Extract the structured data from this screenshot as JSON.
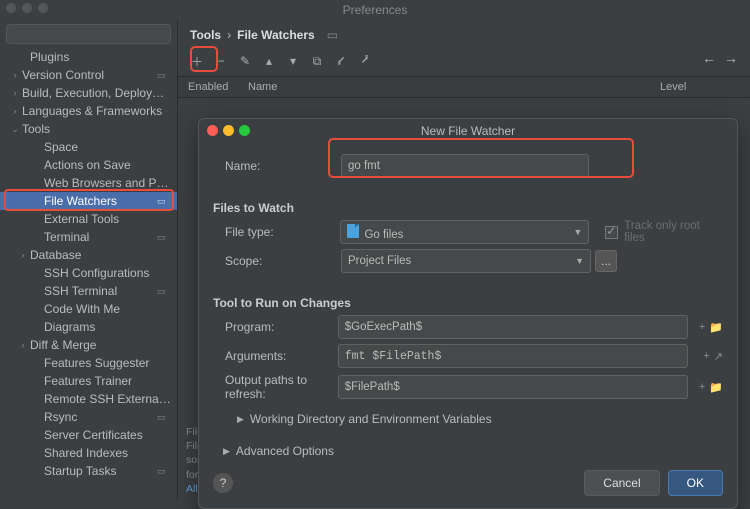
{
  "window_title": "Preferences",
  "breadcrumb": {
    "root": "Tools",
    "leaf": "File Watchers"
  },
  "nav": {
    "back": "←",
    "fwd": "→"
  },
  "search": {
    "placeholder": ""
  },
  "sidebar": [
    {
      "label": "Plugins",
      "exp": "",
      "ind": 2,
      "key": "plugins",
      "i": false
    },
    {
      "label": "Version Control",
      "exp": "›",
      "ind": 1,
      "key": "vcs",
      "i": true,
      "badge": true
    },
    {
      "label": "Build, Execution, Deployment",
      "exp": "›",
      "ind": 1,
      "key": "build",
      "i": true
    },
    {
      "label": "Languages & Frameworks",
      "exp": "›",
      "ind": 1,
      "key": "lang",
      "i": true
    },
    {
      "label": "Tools",
      "exp": "⌄",
      "ind": 1,
      "key": "tools",
      "i": true
    },
    {
      "label": "Space",
      "exp": "",
      "ind": 3,
      "key": "space",
      "i": true
    },
    {
      "label": "Actions on Save",
      "exp": "",
      "ind": 3,
      "key": "actions-save",
      "i": true
    },
    {
      "label": "Web Browsers and Preview",
      "exp": "",
      "ind": 3,
      "key": "web-browsers",
      "i": true
    },
    {
      "label": "File Watchers",
      "exp": "",
      "ind": 3,
      "key": "file-watchers",
      "i": true,
      "sel": true,
      "badge": true
    },
    {
      "label": "External Tools",
      "exp": "",
      "ind": 3,
      "key": "ext-tools",
      "i": true
    },
    {
      "label": "Terminal",
      "exp": "",
      "ind": 3,
      "key": "terminal",
      "i": true,
      "badge": true
    },
    {
      "label": "Database",
      "exp": "›",
      "ind": 2,
      "key": "database",
      "i": true
    },
    {
      "label": "SSH Configurations",
      "exp": "",
      "ind": 3,
      "key": "ssh-conf",
      "i": true
    },
    {
      "label": "SSH Terminal",
      "exp": "",
      "ind": 3,
      "key": "ssh-term",
      "i": true,
      "badge": true
    },
    {
      "label": "Code With Me",
      "exp": "",
      "ind": 3,
      "key": "code-with-me",
      "i": true
    },
    {
      "label": "Diagrams",
      "exp": "",
      "ind": 3,
      "key": "diagrams",
      "i": true
    },
    {
      "label": "Diff & Merge",
      "exp": "›",
      "ind": 2,
      "key": "diff",
      "i": true
    },
    {
      "label": "Features Suggester",
      "exp": "",
      "ind": 3,
      "key": "feat-sug",
      "i": true
    },
    {
      "label": "Features Trainer",
      "exp": "",
      "ind": 3,
      "key": "feat-train",
      "i": true
    },
    {
      "label": "Remote SSH External Tools",
      "exp": "",
      "ind": 3,
      "key": "rssh",
      "i": true
    },
    {
      "label": "Rsync",
      "exp": "",
      "ind": 3,
      "key": "rsync",
      "i": true,
      "badge": true
    },
    {
      "label": "Server Certificates",
      "exp": "",
      "ind": 3,
      "key": "certs",
      "i": true
    },
    {
      "label": "Shared Indexes",
      "exp": "",
      "ind": 3,
      "key": "shared-idx",
      "i": true
    },
    {
      "label": "Startup Tasks",
      "exp": "",
      "ind": 3,
      "key": "startup",
      "i": true,
      "badge": true
    }
  ],
  "table": {
    "h1": "Enabled",
    "h2": "Name",
    "h3": "Level"
  },
  "toolbar": {
    "add": "＋",
    "remove": "−",
    "edit": "✎",
    "up": "▴",
    "down": "▾",
    "copy": "⧉",
    "import": "⭹",
    "export": "⭷"
  },
  "help_text": {
    "line1": "File Watchers track changes to the project files and run configured third-party programs with specified parameters. Use File Watchers to run",
    "line2": "some actions on save and on external change, for example, to transpile edited files or to format code with an external formatter.",
    "link": "All actions on save..."
  },
  "dialog": {
    "title": "New File Watcher",
    "name_label": "Name:",
    "name_value": "go fmt",
    "files_heading": "Files to Watch",
    "filetype_label": "File type:",
    "filetype_value": "Go files",
    "scope_label": "Scope:",
    "scope_value": "Project Files",
    "scope_more": "...",
    "track_root": "Track only root files",
    "tool_heading": "Tool to Run on Changes",
    "program_label": "Program:",
    "program_value": "$GoExecPath$",
    "args_label": "Arguments:",
    "args_value": "fmt $FilePath$",
    "output_label": "Output paths to refresh:",
    "output_value": "$FilePath$",
    "working_dir": "Working Directory and Environment Variables",
    "advanced": "Advanced Options",
    "cancel": "Cancel",
    "ok": "OK",
    "help": "?"
  }
}
